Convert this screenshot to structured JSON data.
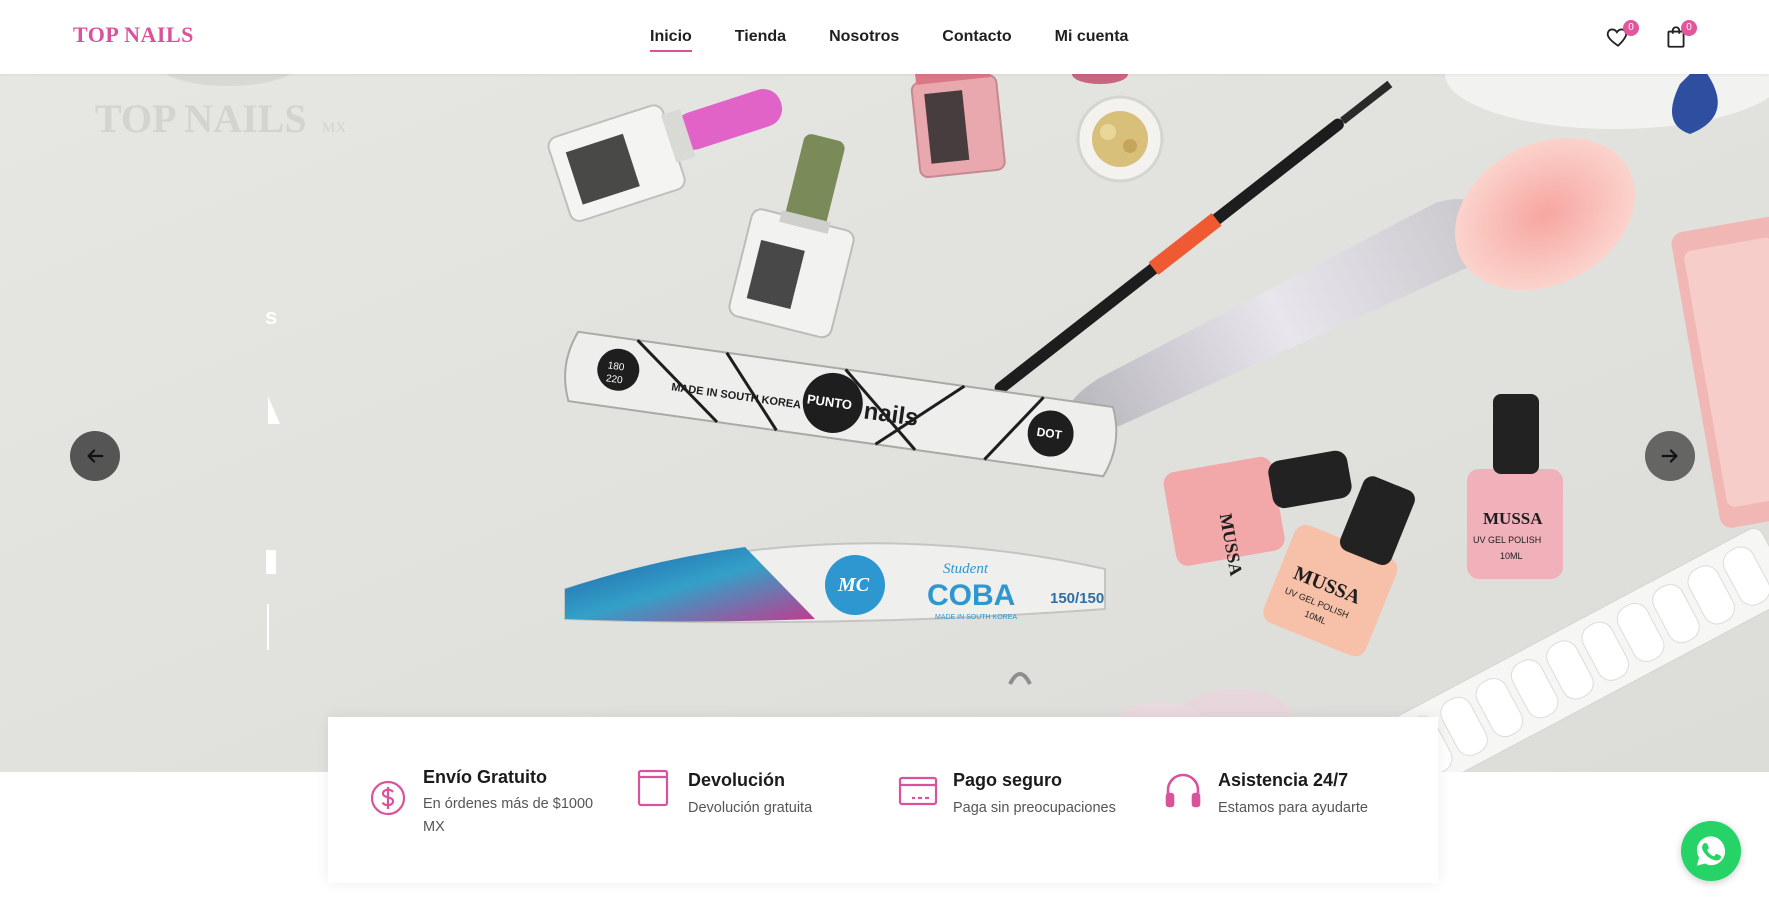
{
  "header": {
    "logo": "TOP NAILS",
    "nav": [
      "Inicio",
      "Tienda",
      "Nosotros",
      "Contacto",
      "Mi cuenta"
    ],
    "active_nav": "Inicio",
    "wishlist_count": "0",
    "cart_count": "0"
  },
  "hero": {
    "watermark_logo": "TOP NAILS",
    "watermark_suffix": "MX",
    "products": {
      "file_brand": "PUNTO nails",
      "file_origin": "MADE IN SOUTH KOREA",
      "file_grit": "180 220",
      "file_dot": "DOT",
      "coba_brand": "MC",
      "coba_label": "Student COBA",
      "coba_origin": "MADE IN SOUTH KOREA",
      "coba_grit": "150/150",
      "polish_brand": "MUSSA",
      "polish_label": "UV GEL POLISH",
      "polish_size": "10ML"
    }
  },
  "features": [
    {
      "icon": "dollar-icon",
      "title": "Envío Gratuito",
      "desc": "En órdenes más de $1000 MX"
    },
    {
      "icon": "return-icon",
      "title": "Devolución",
      "desc": "Devolución gratuita"
    },
    {
      "icon": "credit-card-icon",
      "title": "Pago seguro",
      "desc": "Paga sin preocupaciones"
    },
    {
      "icon": "headset-icon",
      "title": "Asistencia 24/7",
      "desc": "Estamos para ayudarte"
    }
  ],
  "colors": {
    "accent": "#d9539c",
    "whatsapp": "#25d366"
  }
}
